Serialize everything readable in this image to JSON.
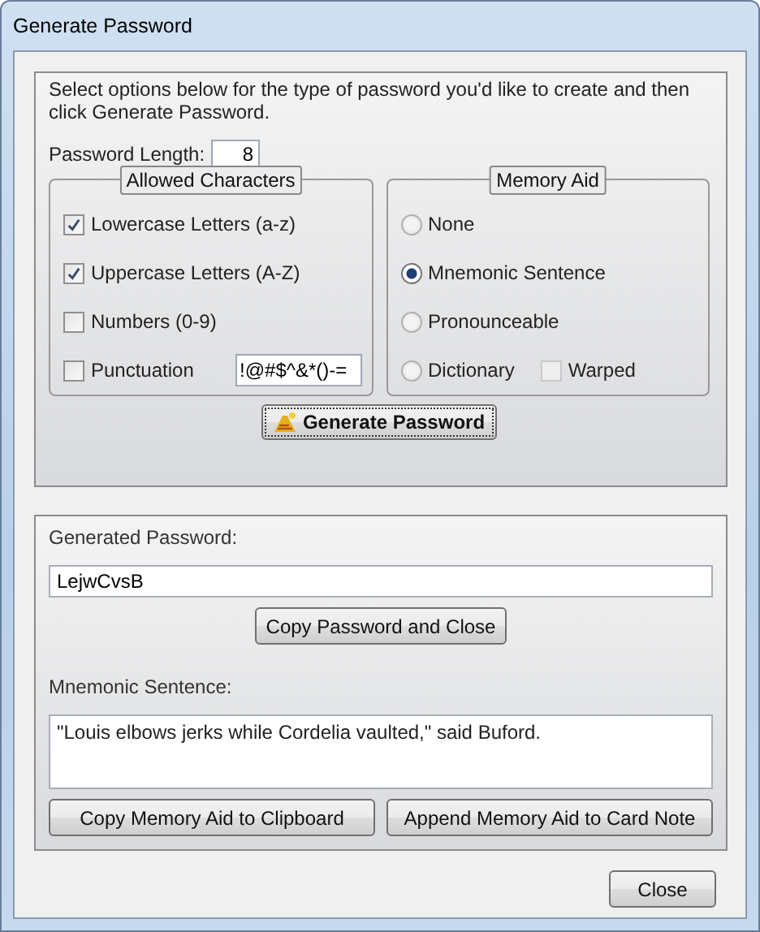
{
  "window": {
    "title": "Generate Password"
  },
  "instructions": "Select options below for the type of password you'd like to create and then click Generate Password.",
  "password_length": {
    "label": "Password Length:",
    "value": "8"
  },
  "allowed_characters": {
    "title": "Allowed Characters",
    "options": [
      {
        "label": "Lowercase Letters (a-z)",
        "checked": true
      },
      {
        "label": "Uppercase Letters (A-Z)",
        "checked": true
      },
      {
        "label": "Numbers (0-9)",
        "checked": false
      },
      {
        "label": "Punctuation",
        "checked": false,
        "value": "!@#$^&*()-="
      }
    ]
  },
  "memory_aid": {
    "title": "Memory Aid",
    "options": [
      {
        "label": "None",
        "selected": false
      },
      {
        "label": "Mnemonic Sentence",
        "selected": true
      },
      {
        "label": "Pronounceable",
        "selected": false
      },
      {
        "label": "Dictionary",
        "selected": false
      }
    ],
    "warped": {
      "label": "Warped",
      "checked": false,
      "disabled": true
    }
  },
  "generate_button": "Generate Password",
  "generated_password": {
    "label": "Generated Password:",
    "value": "LejwCvsB"
  },
  "copy_password_button": "Copy Password and Close",
  "mnemonic": {
    "label": "Mnemonic Sentence:",
    "value": "\"Louis elbows jerks while Cordelia vaulted,\" said Buford."
  },
  "memory_buttons": [
    "Copy Memory Aid to Clipboard",
    "Append Memory Aid to Card Note"
  ],
  "close_button": "Close"
}
